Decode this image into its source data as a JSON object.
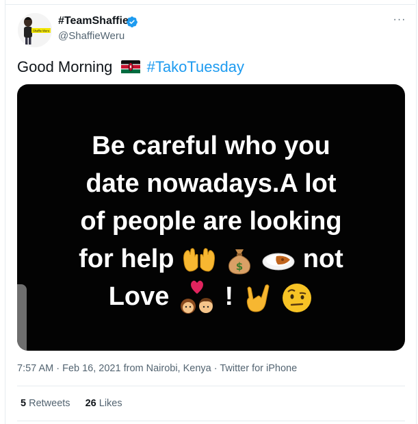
{
  "author": {
    "display_name": "#TeamShaffie",
    "handle": "@ShaffieWeru",
    "verified": true,
    "avatar_badge_text": "Shaffie Weru"
  },
  "more_menu": "···",
  "tweet": {
    "text": "Good Morning",
    "flag_icon": "kenya-flag-icon",
    "hashtag": "#TakoTuesday"
  },
  "media": {
    "quote_lines": [
      "Be careful who you",
      "date nowadays.A lot",
      "of people are looking",
      "for help",
      "not",
      "Love",
      "!"
    ],
    "emoji_icons": [
      "open-hands-icon",
      "money-bag-icon",
      "curry-rice-icon",
      "couple-with-heart-icon",
      "love-you-gesture-icon",
      "raised-eyebrow-face-icon"
    ]
  },
  "meta": {
    "time": "7:57 AM",
    "sep1": " · ",
    "date": "Feb 16, 2021",
    "from": " from ",
    "location": "Nairobi, Kenya",
    "sep2": " · ",
    "source": "Twitter for iPhone"
  },
  "stats": {
    "retweets_count": "5",
    "retweets_label": "Retweets",
    "likes_count": "26",
    "likes_label": "Likes"
  },
  "colors": {
    "accent": "#1d9bf0",
    "secondary_text": "#536471",
    "media_bg": "#030303"
  }
}
